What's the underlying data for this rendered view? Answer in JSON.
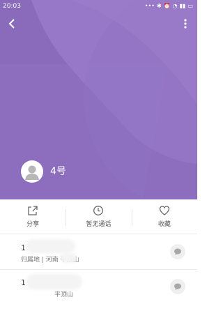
{
  "status_bar": {
    "time": "20:03",
    "icons": [
      "more-dots-icon",
      "bluetooth-icon",
      "alarm-icon",
      "wifi-icon",
      "signal-icon",
      "battery-icon"
    ]
  },
  "header": {
    "background_color": "#8a6bbb",
    "back_icon": "back-arrow-icon",
    "more_icon": "more-vertical-icon",
    "contact_name": "4号"
  },
  "actions": [
    {
      "label": "分享",
      "icon": "share-icon"
    },
    {
      "label": "暂无通话",
      "icon": "clock-icon"
    },
    {
      "label": "收藏",
      "icon": "heart-icon"
    }
  ],
  "records": [
    {
      "number": "1",
      "location": "归属地 | 河南 平顶山",
      "message_icon": "message-icon"
    },
    {
      "number": "1",
      "location": "平顶山",
      "message_icon": "message-icon"
    }
  ]
}
